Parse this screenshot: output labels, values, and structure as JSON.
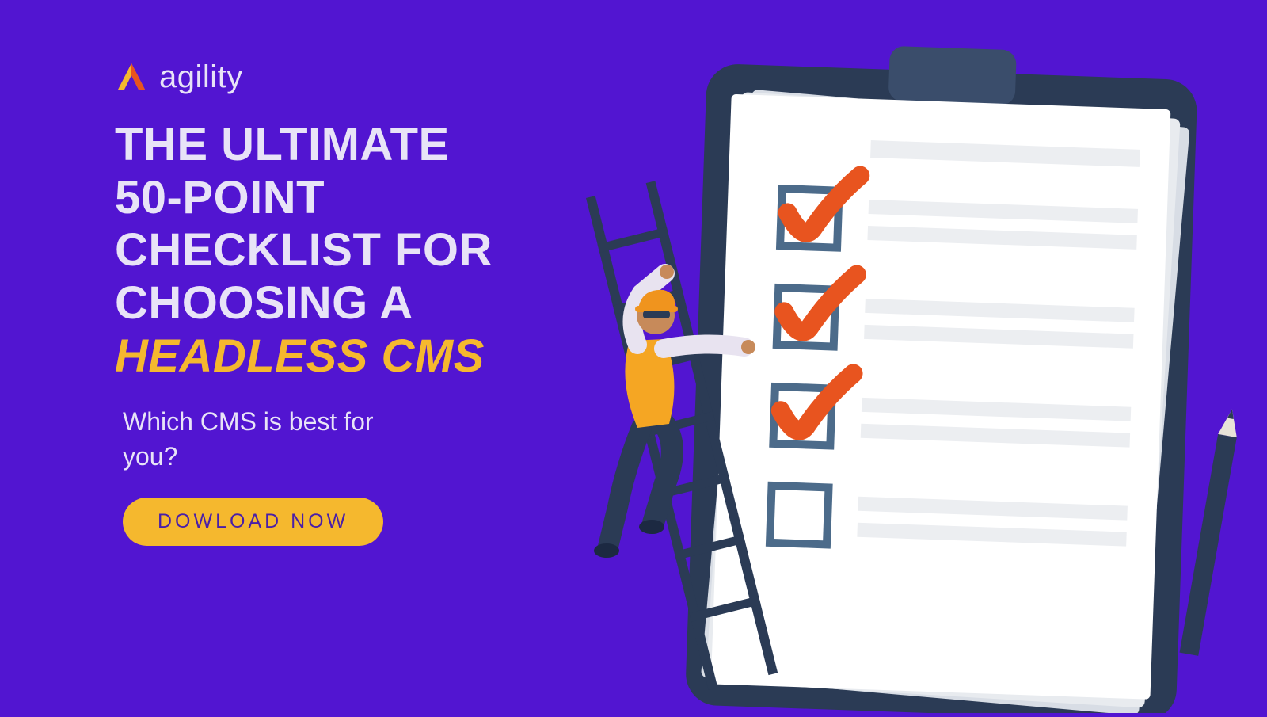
{
  "brand": {
    "name": "agility"
  },
  "headline": {
    "line1": "THE ULTIMATE",
    "line2": "50-POINT",
    "line3": "CHECKLIST FOR",
    "line4": "CHOOSING A",
    "line5_accent": "HEADLESS CMS"
  },
  "subhead": "Which CMS is best for you?",
  "cta_label": "DOWLOAD NOW",
  "colors": {
    "background": "#5215d1",
    "text": "#e8e3f7",
    "accent_yellow": "#f5b82e",
    "accent_orange": "#e8541f",
    "clipboard": "#2b3b55",
    "checkbox_border": "#4c6b8a"
  }
}
